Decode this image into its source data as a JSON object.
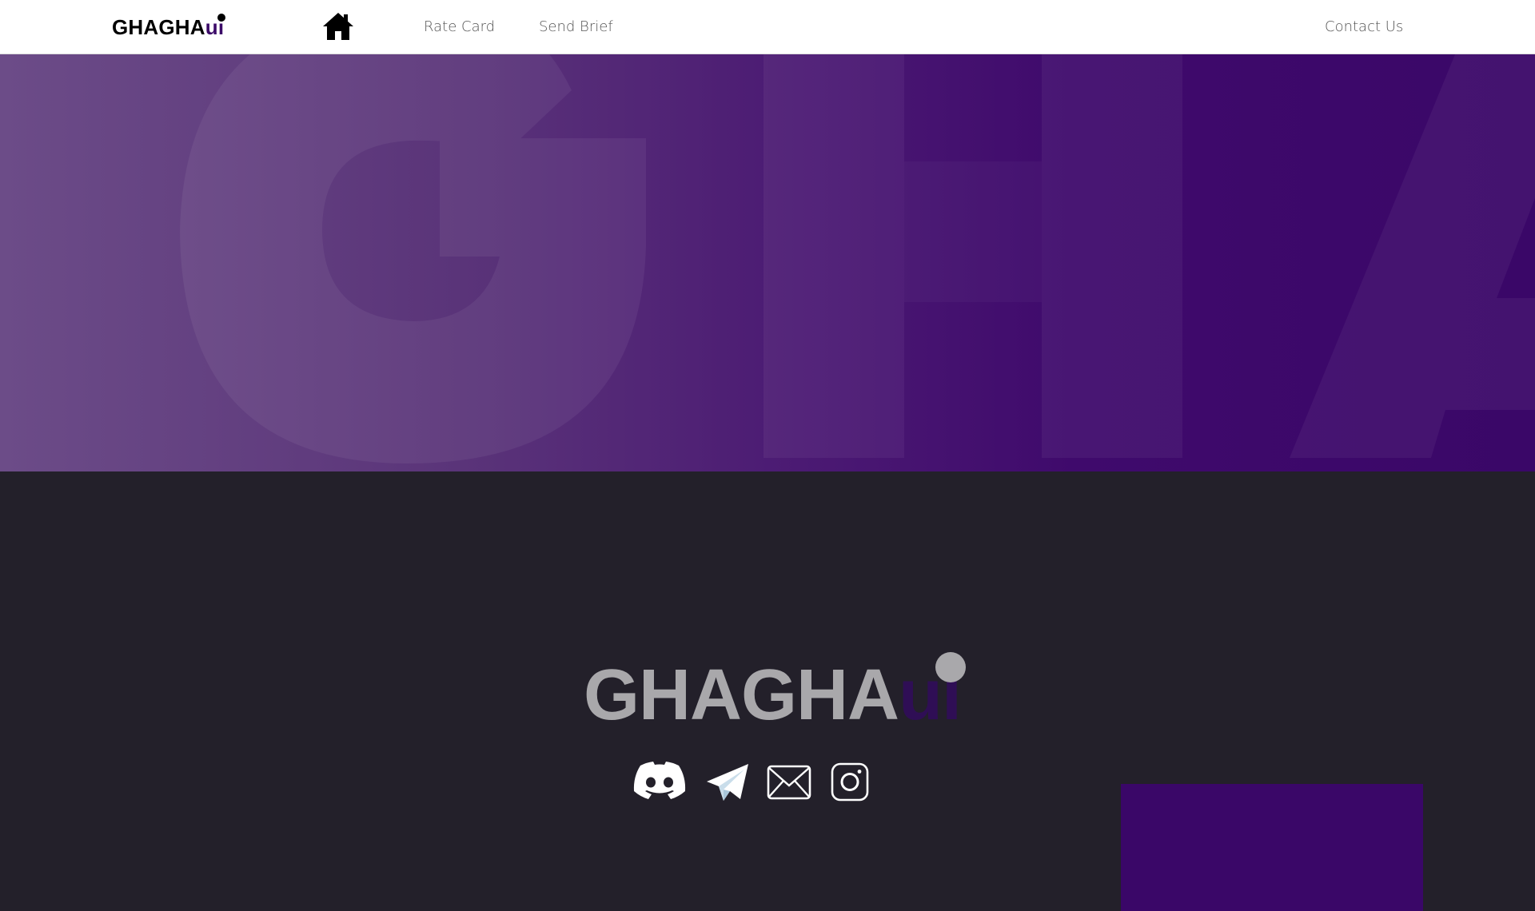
{
  "nav": {
    "brand_main": "GHAGHA",
    "brand_accent": "ui",
    "home_icon": "home-icon",
    "links": [
      {
        "label": "Rate Card"
      },
      {
        "label": "Send Brief"
      }
    ],
    "contact_label": "Contact Us"
  },
  "hero": {
    "watermark_text": "GHAGHA",
    "colors": {
      "gradient_start": "#6c4c88",
      "gradient_end": "#3a0768"
    }
  },
  "footer": {
    "logo_main": "GHAGHA",
    "logo_accent": "ui",
    "socials": [
      {
        "icon": "discord-icon"
      },
      {
        "icon": "telegram-icon"
      },
      {
        "icon": "mail-icon"
      },
      {
        "icon": "instagram-icon"
      }
    ]
  },
  "colors": {
    "brand_purple": "#3b0a68",
    "footer_bg": "#23202a",
    "logo_gray": "#a9a8ab"
  }
}
